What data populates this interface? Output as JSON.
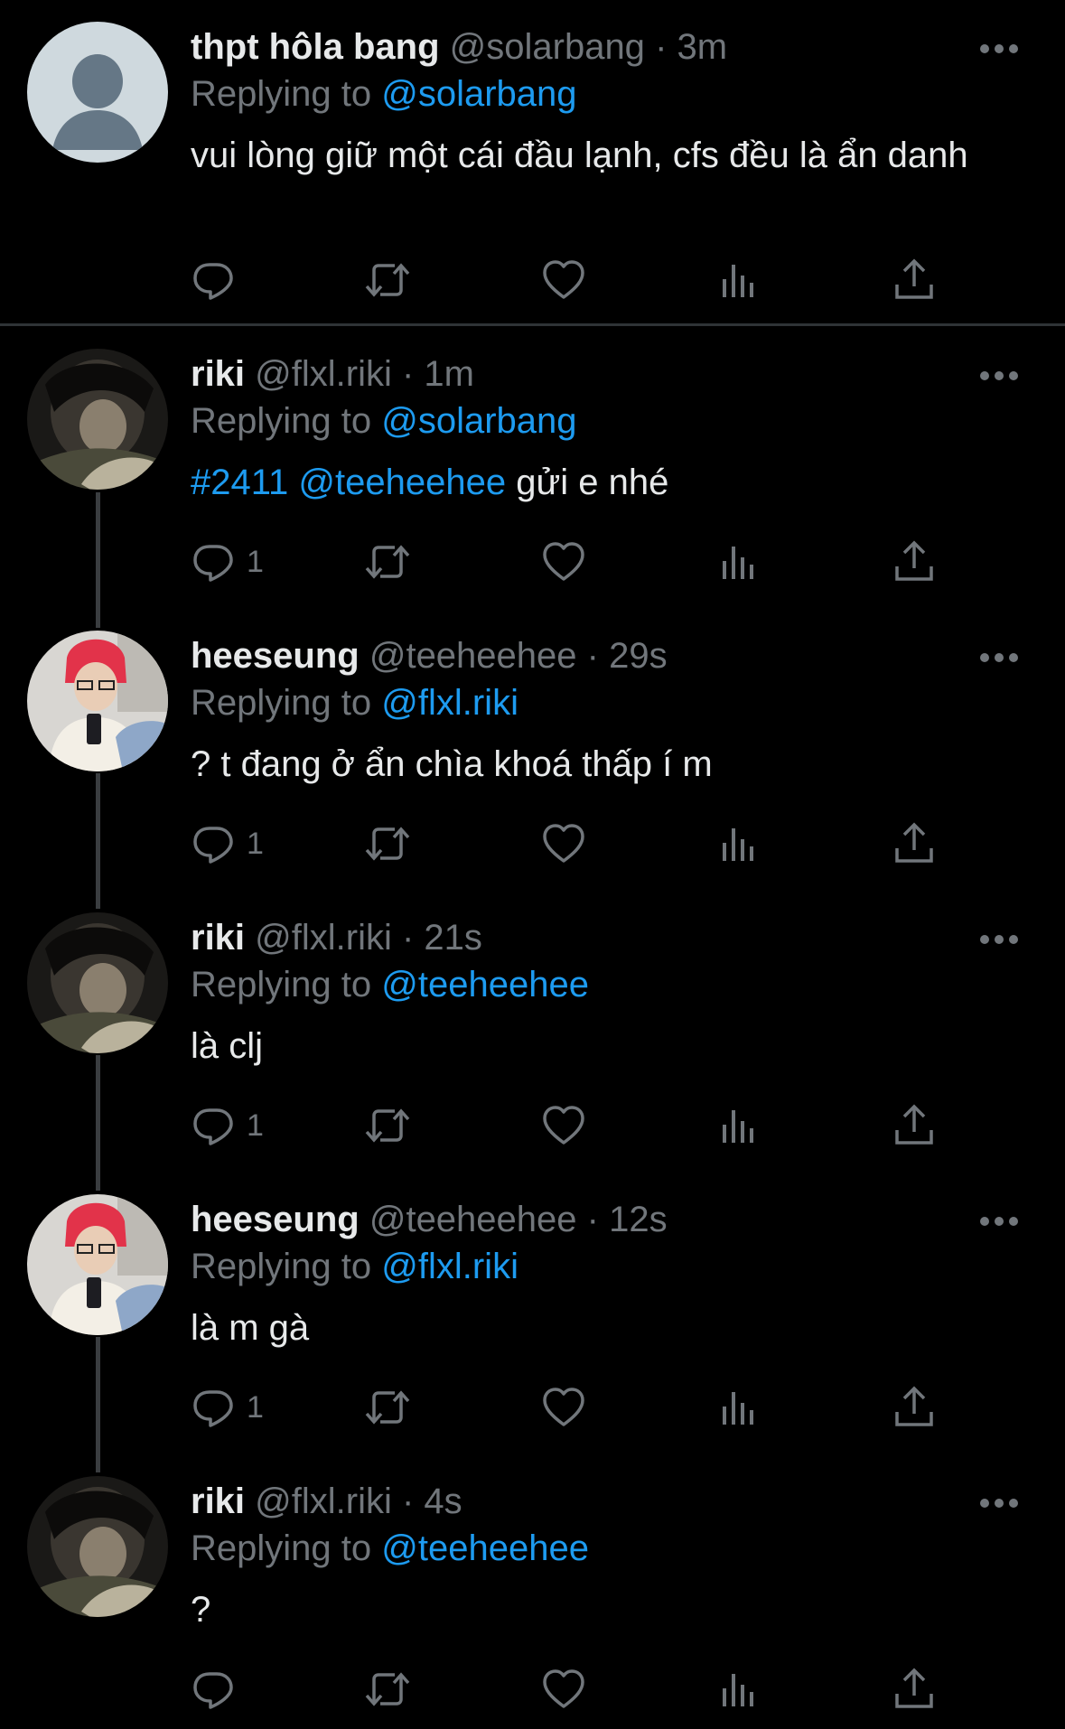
{
  "tweets": [
    {
      "name": "thpt hôla bang",
      "handle": "@solarbang",
      "time": "· 3m",
      "replying_prefix": "Replying to",
      "replying_to": "@solarbang",
      "text": "vui lòng giữ một cái đầu lạnh, cfs đều là ẩn danh",
      "reply_count": "",
      "avatar": "default-avatar"
    },
    {
      "name": "riki",
      "handle": "@flxl.riki",
      "time": "· 1m",
      "replying_prefix": "Replying to",
      "replying_to": "@solarbang",
      "text_hashtag": "#2411",
      "text_mention": "@teeheehee",
      "text_rest": "gửi e nhé",
      "reply_count": "1",
      "avatar": "riki-avatar"
    },
    {
      "name": "heeseung",
      "handle": "@teeheehee",
      "time": "· 29s",
      "replying_prefix": "Replying to",
      "replying_to": "@flxl.riki",
      "text": "? t đang ở ẩn chìa khoá thấp í m",
      "reply_count": "1",
      "avatar": "heeseung-avatar"
    },
    {
      "name": "riki",
      "handle": "@flxl.riki",
      "time": "· 21s",
      "replying_prefix": "Replying to",
      "replying_to": "@teeheehee",
      "text": "là clj",
      "reply_count": "1",
      "avatar": "riki-avatar"
    },
    {
      "name": "heeseung",
      "handle": "@teeheehee",
      "time": "· 12s",
      "replying_prefix": "Replying to",
      "replying_to": "@flxl.riki",
      "text": "là m gà",
      "reply_count": "1",
      "avatar": "heeseung-avatar"
    },
    {
      "name": "riki",
      "handle": "@flxl.riki",
      "time": "· 4s",
      "replying_prefix": "Replying to",
      "replying_to": "@teeheehee",
      "text": "?",
      "reply_count": "",
      "avatar": "riki-avatar"
    }
  ],
  "icons": {
    "reply": "reply-icon",
    "retweet": "retweet-icon",
    "like": "heart-icon",
    "views": "views-icon",
    "share": "share-icon",
    "more": "more-icon"
  },
  "colors": {
    "background": "#000000",
    "text": "#e7e9ea",
    "muted": "#71767b",
    "link": "#1d9bf0",
    "divider": "#2f3336"
  }
}
